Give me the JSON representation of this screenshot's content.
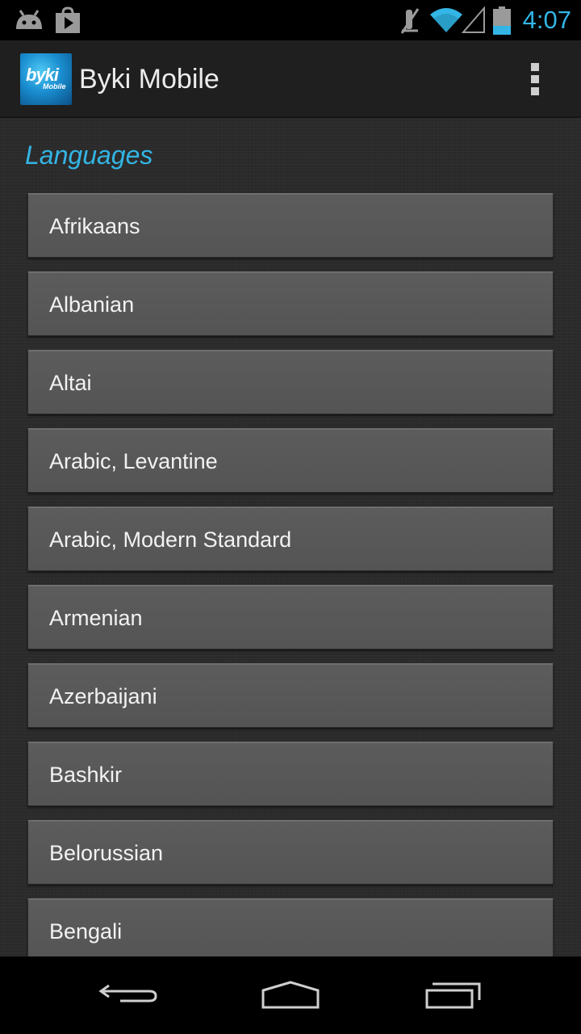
{
  "status_bar": {
    "time": "4:07",
    "icons": [
      "android-notification-icon",
      "play-store-icon",
      "mute-icon",
      "wifi-icon",
      "signal-icon",
      "battery-icon"
    ]
  },
  "action_bar": {
    "logo_text": "byki",
    "logo_sub": "Mobile",
    "title": "Byki Mobile",
    "overflow_icon": "overflow-menu-icon"
  },
  "section": {
    "title": "Languages"
  },
  "languages": [
    "Afrikaans",
    "Albanian",
    "Altai",
    "Arabic, Levantine",
    "Arabic, Modern Standard",
    "Armenian",
    "Azerbaijani",
    "Bashkir",
    "Belorussian",
    "Bengali"
  ],
  "nav_bar": {
    "icons": [
      "back-icon",
      "home-icon",
      "recent-apps-icon"
    ]
  },
  "colors": {
    "accent": "#33b5e5",
    "action_bar": "#1f1f1f",
    "list_item": "#5a5a5a"
  }
}
